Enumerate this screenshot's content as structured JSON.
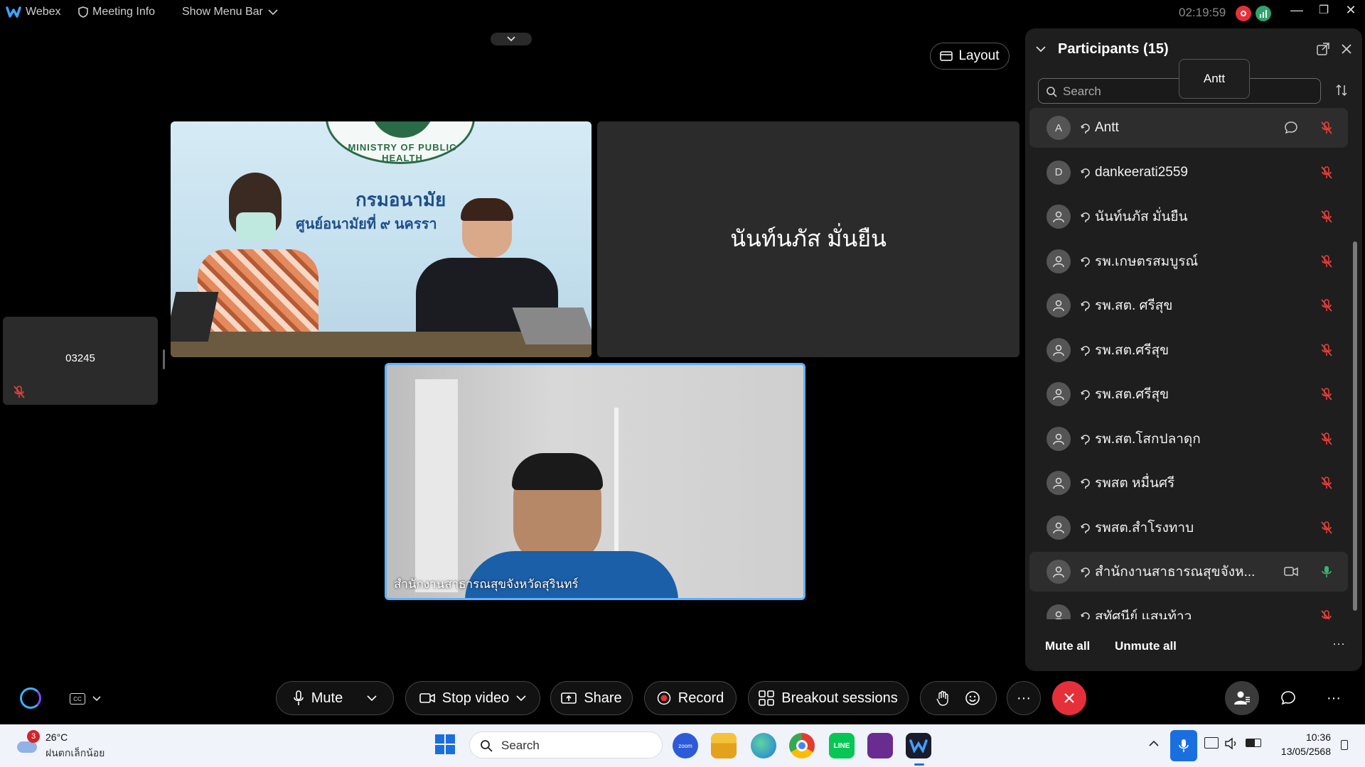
{
  "topbar": {
    "app_name": "Webex",
    "meeting_info": "Meeting Info",
    "show_menu_bar": "Show Menu Bar",
    "timer": "02:19:59"
  },
  "stage": {
    "layout_label": "Layout",
    "tiles": [
      {
        "name": "03245",
        "kind": "name-only-small",
        "muted": true
      },
      {
        "name": "",
        "kind": "video-room",
        "sign_line1": "กรมอนามัย",
        "sign_line2": "ศูนย์อนามัยที่ ๙ นครรา",
        "seal_text": "MINISTRY OF PUBLIC HEALTH"
      },
      {
        "name": "นันท์นภัส มั่นยืน",
        "kind": "name-only"
      },
      {
        "name": "สำนักงานสาธารณสุขจังหวัดสุรินทร์",
        "kind": "video-active-speaker"
      }
    ]
  },
  "participants": {
    "title": "Participants (15)",
    "search_placeholder": "Search",
    "tooltip": "Antt",
    "list": [
      {
        "name": "Antt",
        "avatar": "A",
        "muted": true,
        "has_chat": true,
        "highlight": true
      },
      {
        "name": "dankeerati2559",
        "avatar": "D",
        "muted": true
      },
      {
        "name": "นันท์นภัส มั่นยืน",
        "avatar": "person",
        "muted": true
      },
      {
        "name": "รพ.เกษตรสมบูรณ์",
        "avatar": "person",
        "muted": true
      },
      {
        "name": "รพ.สต. ศรีสุข",
        "avatar": "person",
        "muted": true
      },
      {
        "name": "รพ.สต.ศรีสุข",
        "avatar": "person",
        "muted": true
      },
      {
        "name": "รพ.สต.ศรีสุข",
        "avatar": "person",
        "muted": true
      },
      {
        "name": "รพ.สต.โสกปลาดุก",
        "avatar": "person",
        "muted": true
      },
      {
        "name": "รพสต หมื่นศรี",
        "avatar": "person",
        "muted": true
      },
      {
        "name": "รพสต.สำโรงทาบ",
        "avatar": "person",
        "muted": true
      },
      {
        "name": "สำนักงานสาธารณสุขจังห...",
        "avatar": "person",
        "muted": false,
        "video": true,
        "highlight": true
      },
      {
        "name": "สุทัศนีย์ แสนท้าว",
        "avatar": "person",
        "muted": true
      }
    ],
    "mute_all": "Mute all",
    "unmute_all": "Unmute all"
  },
  "controls": {
    "mute": "Mute",
    "stop_video": "Stop video",
    "share": "Share",
    "record": "Record",
    "breakout": "Breakout sessions"
  },
  "taskbar": {
    "weather_badge": "3",
    "temperature": "26°C",
    "weather_desc": "ฝนตกเล็กน้อย",
    "search": "Search",
    "time": "10:36",
    "date": "13/05/2568"
  },
  "colors": {
    "accent_blue": "#5eb1ff",
    "end_red": "#e5303a",
    "mute_red": "#e5403a",
    "active_green": "#3bb273"
  }
}
